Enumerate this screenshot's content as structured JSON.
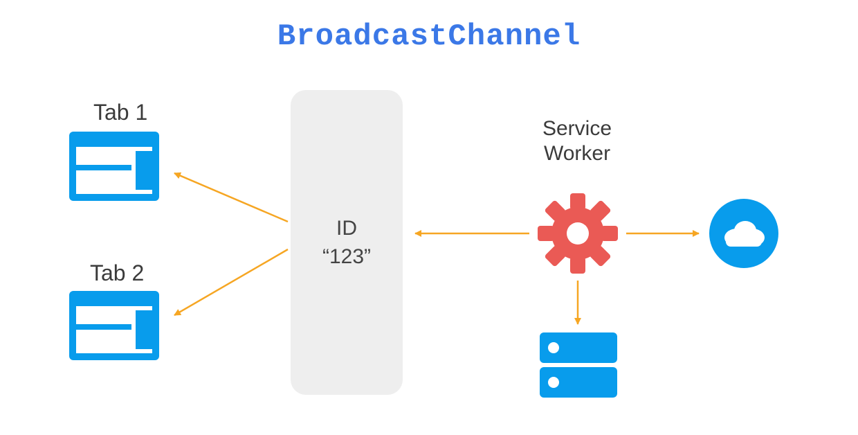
{
  "title": "BroadcastChannel",
  "tabs": [
    {
      "label": "Tab 1"
    },
    {
      "label": "Tab 2"
    }
  ],
  "channel": {
    "id_label": "ID",
    "id_value": "“123”"
  },
  "service_worker": {
    "label_line1": "Service",
    "label_line2": "Worker"
  },
  "icons": {
    "tab": "browser-window-icon",
    "gear": "gear-icon",
    "storage": "storage-icon",
    "cloud": "cloud-icon"
  },
  "colors": {
    "title": "#3b78e7",
    "accent_blue": "#089cec",
    "accent_red": "#ea5a55",
    "arrow": "#f6a623",
    "channel_bg": "#eeeeee",
    "text": "#3b3b3b"
  }
}
